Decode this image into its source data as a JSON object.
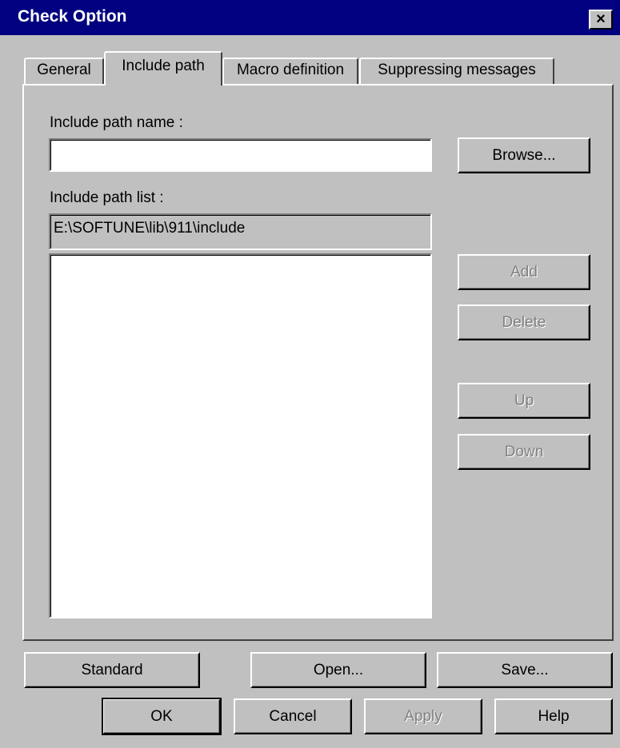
{
  "window": {
    "title": "Check Option",
    "close_glyph": "×"
  },
  "tabs": [
    {
      "label": "General",
      "active": false
    },
    {
      "label": "Include path",
      "active": true
    },
    {
      "label": "Macro definition",
      "active": false
    },
    {
      "label": "Suppressing messages",
      "active": false
    }
  ],
  "include_path_name": {
    "label": "Include path name :",
    "value": "",
    "browse_label": "Browse..."
  },
  "include_path_list": {
    "label": "Include path list :",
    "selected_path": "E:\\SOFTUNE\\lib\\911\\include",
    "items": []
  },
  "side_buttons": {
    "add": "Add",
    "delete": "Delete",
    "up": "Up",
    "down": "Down"
  },
  "bottom_row1": {
    "standard": "Standard",
    "open": "Open...",
    "save": "Save..."
  },
  "bottom_row2": {
    "ok": "OK",
    "cancel": "Cancel",
    "apply": "Apply",
    "help": "Help"
  },
  "colors": {
    "titlebar": "#000080",
    "face": "#c0c0c0",
    "disabled_text": "#808080"
  }
}
